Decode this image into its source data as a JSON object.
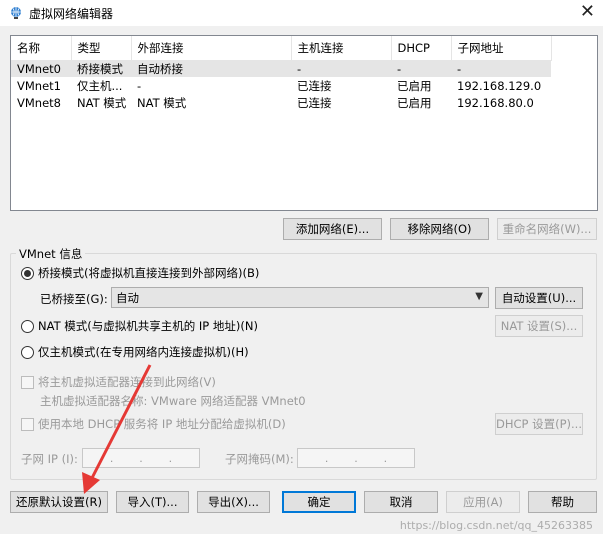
{
  "window": {
    "title": "虚拟网络编辑器",
    "close_label": "✕"
  },
  "network_list": {
    "columns": [
      "名称",
      "类型",
      "外部连接",
      "主机连接",
      "DHCP",
      "子网地址"
    ],
    "rows": [
      [
        "VMnet0",
        "桥接模式",
        "自动桥接",
        "-",
        "-",
        "-"
      ],
      [
        "VMnet1",
        "仅主机...",
        "-",
        "已连接",
        "已启用",
        "192.168.129.0"
      ],
      [
        "VMnet8",
        "NAT 模式",
        "NAT 模式",
        "已连接",
        "已启用",
        "192.168.80.0"
      ]
    ],
    "selected_index": 0
  },
  "list_buttons": {
    "add": "添加网络(E)...",
    "remove": "移除网络(O)",
    "rename": "重命名网络(W)..."
  },
  "vmnet_info": {
    "legend": "VMnet 信息",
    "bridged_radio": "桥接模式(将虚拟机直接连接到外部网络)(B)",
    "bridged_to_label": "已桥接至(G):",
    "bridged_to_value": "自动",
    "auto_settings_button": "自动设置(U)...",
    "nat_radio": "NAT 模式(与虚拟机共享主机的 IP 地址)(N)",
    "nat_settings_button": "NAT 设置(S)...",
    "host_only_radio": "仅主机模式(在专用网络内连接虚拟机)(H)",
    "selected_mode": "bridged",
    "connect_adapter_check": "将主机虚拟适配器连接到此网络(V)",
    "adapter_name_text": "主机虚拟适配器名称: VMware 网络适配器 VMnet0",
    "dhcp_check": "使用本地 DHCP 服务将 IP 地址分配给虚拟机(D)",
    "dhcp_settings_button": "DHCP 设置(P)...",
    "subnet_ip_label": "子网 IP (I):",
    "subnet_mask_label": "子网掩码(M):"
  },
  "footer_buttons": {
    "restore": "还原默认设置(R)",
    "import": "导入(T)...",
    "export": "导出(X)...",
    "ok": "确定",
    "cancel": "取消",
    "apply": "应用(A)",
    "help": "帮助"
  },
  "watermark": "https://blog.csdn.net/qq_45263385",
  "colors": {
    "accent": "#0078d7",
    "arrow": "#e53935"
  }
}
